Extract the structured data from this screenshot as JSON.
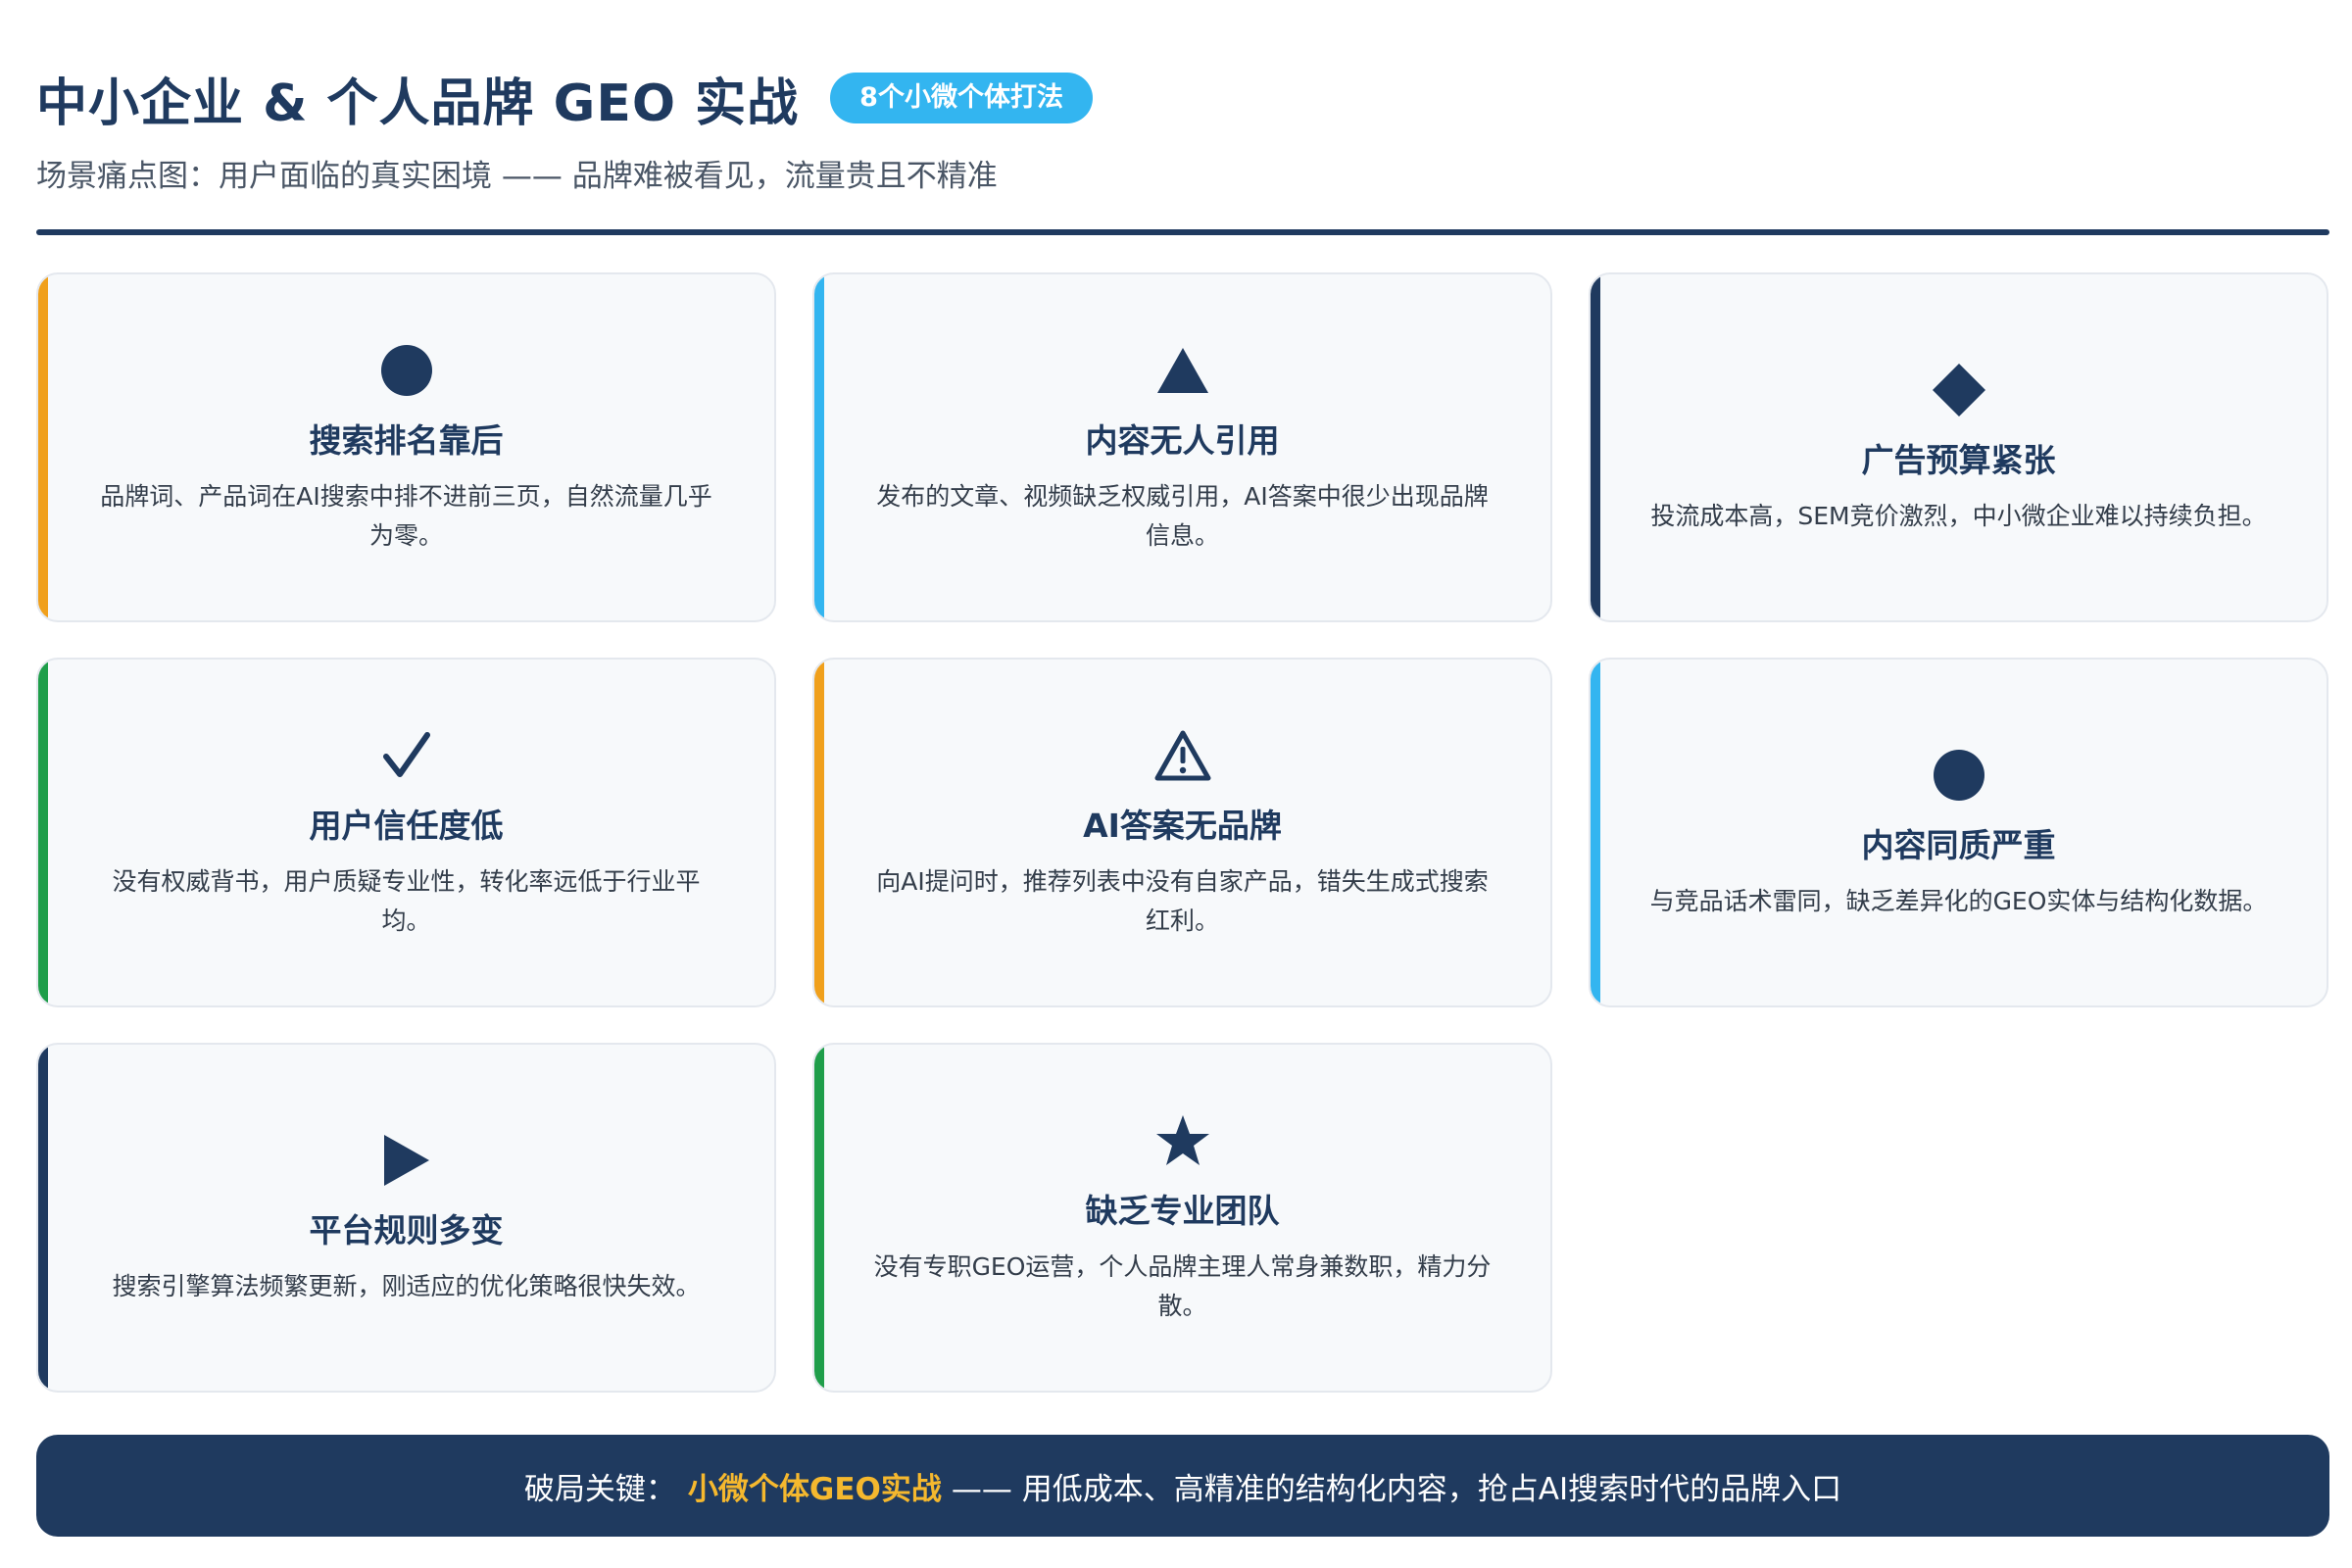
{
  "header": {
    "title": "中小企业 & 个人品牌 GEO 实战",
    "badge": "8个小微个体打法",
    "subtitle": "场景痛点图：用户面临的真实困境 —— 品牌难被看见，流量贵且不精准"
  },
  "colors": {
    "navy": "#1f3a5f",
    "orange": "#f0a01c",
    "sky": "#33b5f0",
    "green": "#1f9e4a",
    "gold": "#f5b82e"
  },
  "cards": [
    {
      "icon": "circle-icon",
      "accent": "#f0a01c",
      "title": "搜索排名靠后",
      "desc": "品牌词、产品词在AI搜索中排不进前三页，自然流量几乎为零。"
    },
    {
      "icon": "triangle-icon",
      "accent": "#33b5f0",
      "title": "内容无人引用",
      "desc": "发布的文章、视频缺乏权威引用，AI答案中很少出现品牌信息。"
    },
    {
      "icon": "diamond-icon",
      "accent": "#1f3a5f",
      "title": "广告预算紧张",
      "desc": "投流成本高，SEM竞价激烈，中小微企业难以持续负担。"
    },
    {
      "icon": "check-icon",
      "accent": "#1f9e4a",
      "title": "用户信任度低",
      "desc": "没有权威背书，用户质疑专业性，转化率远低于行业平均。"
    },
    {
      "icon": "warning-icon",
      "accent": "#f0a01c",
      "title": "AI答案无品牌",
      "desc": "向AI提问时，推荐列表中没有自家产品，错失生成式搜索红利。"
    },
    {
      "icon": "circle-icon",
      "accent": "#33b5f0",
      "title": "内容同质严重",
      "desc": "与竞品话术雷同，缺乏差异化的GEO实体与结构化数据。"
    },
    {
      "icon": "play-icon",
      "accent": "#1f3a5f",
      "title": "平台规则多变",
      "desc": "搜索引擎算法频繁更新，刚适应的优化策略很快失效。"
    },
    {
      "icon": "star-icon",
      "accent": "#1f9e4a",
      "title": "缺乏专业团队",
      "desc": "没有专职GEO运营，个人品牌主理人常身兼数职，精力分散。"
    }
  ],
  "footer": {
    "prefix": "破局关键：",
    "highlight": "小微个体GEO实战",
    "suffix": "—— 用低成本、高精准的结构化内容，抢占AI搜索时代的品牌入口"
  }
}
